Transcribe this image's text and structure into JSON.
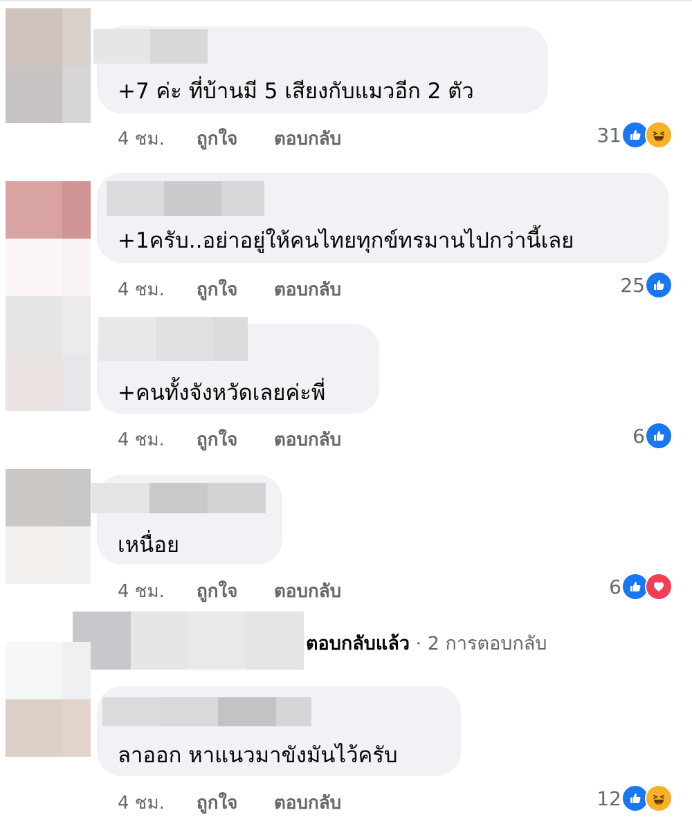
{
  "comments": [
    {
      "text": "+7 ค่ะ ที่บ้านมี 5 เสียงกับแมวอีก 2 ตัว",
      "time": "4 ชม.",
      "like_label": "ถูกใจ",
      "reply_label": "ตอบกลับ",
      "reaction_count": "31",
      "reactions": [
        "like-icon",
        "haha-icon"
      ]
    },
    {
      "text": "+1ครับ..อย่าอยู่ให้คนไทยทุกข์ทรมานไปกว่านี้เลย",
      "time": "4 ชม.",
      "like_label": "ถูกใจ",
      "reply_label": "ตอบกลับ",
      "reaction_count": "25",
      "reactions": [
        "like-icon"
      ]
    },
    {
      "text": "+คนทั้งจังหวัดเลยค่ะพี่",
      "time": "4 ชม.",
      "like_label": "ถูกใจ",
      "reply_label": "ตอบกลับ",
      "reaction_count": "6",
      "reactions": [
        "like-icon"
      ]
    },
    {
      "text": "เหนื่อย",
      "time": "4 ชม.",
      "like_label": "ถูกใจ",
      "reply_label": "ตอบกลับ",
      "reaction_count": "6",
      "reactions": [
        "like-icon",
        "love-icon"
      ]
    },
    {
      "text": "ลาออก หาแนวมาขังมันไว้ครับ",
      "time": "4 ชม.",
      "like_label": "ถูกใจ",
      "reply_label": "ตอบกลับ",
      "reaction_count": "12",
      "reactions": [
        "like-icon",
        "haha-icon"
      ]
    }
  ],
  "replies_summary": {
    "replied": "ตอบกลับแล้ว",
    "separator": " · ",
    "count_text": "2 การตอบกลับ"
  },
  "colors": {
    "bubble": "#f0f2f5",
    "meta_text": "#65676b",
    "like": "#1877f2",
    "love": "#f33e58",
    "haha": "#f7b125"
  }
}
